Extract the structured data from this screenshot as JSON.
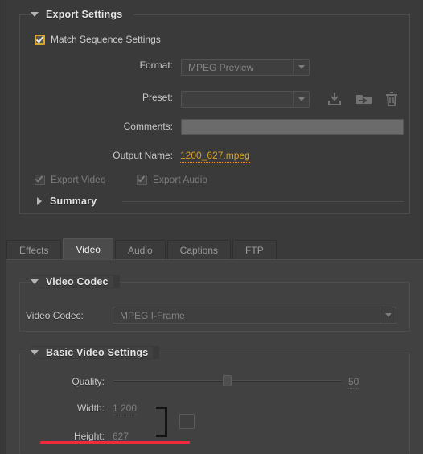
{
  "export_settings": {
    "title": "Export Settings",
    "match_sequence": {
      "label": "Match Sequence Settings",
      "checked": "true"
    },
    "format": {
      "label": "Format:",
      "value": "MPEG Preview"
    },
    "preset": {
      "label": "Preset:",
      "value": ""
    },
    "preset_tools": {
      "save": "save-preset-icon",
      "import": "import-preset-icon",
      "delete": "delete-preset-icon"
    },
    "comments": {
      "label": "Comments:",
      "value": "",
      "placeholder": ""
    },
    "output_name": {
      "label": "Output Name:",
      "value": "1200_627.mpeg"
    },
    "export_video": {
      "label": "Export Video",
      "checked": "true"
    },
    "export_audio": {
      "label": "Export Audio",
      "checked": "true"
    },
    "summary": {
      "title": "Summary"
    }
  },
  "tabs": [
    {
      "label": "Effects",
      "active": "false"
    },
    {
      "label": "Video",
      "active": "true"
    },
    {
      "label": "Audio",
      "active": "false"
    },
    {
      "label": "Captions",
      "active": "false"
    },
    {
      "label": "FTP",
      "active": "false"
    }
  ],
  "video_codec": {
    "title": "Video Codec",
    "field_label": "Video Codec:",
    "value": "MPEG I-Frame"
  },
  "basic_video_settings": {
    "title": "Basic Video Settings",
    "quality": {
      "label": "Quality:",
      "value": "50",
      "min": "0",
      "max": "100",
      "percent": 50
    },
    "width": {
      "label": "Width:",
      "value": "1 200"
    },
    "height": {
      "label": "Height:",
      "value": "627"
    },
    "link_constraint": {
      "checked": "false"
    }
  },
  "colors": {
    "accent": "#d9a11e",
    "annotation": "#ef2b3b",
    "panel": "#3a3a3a",
    "tab_active": "#4b4b4b"
  }
}
